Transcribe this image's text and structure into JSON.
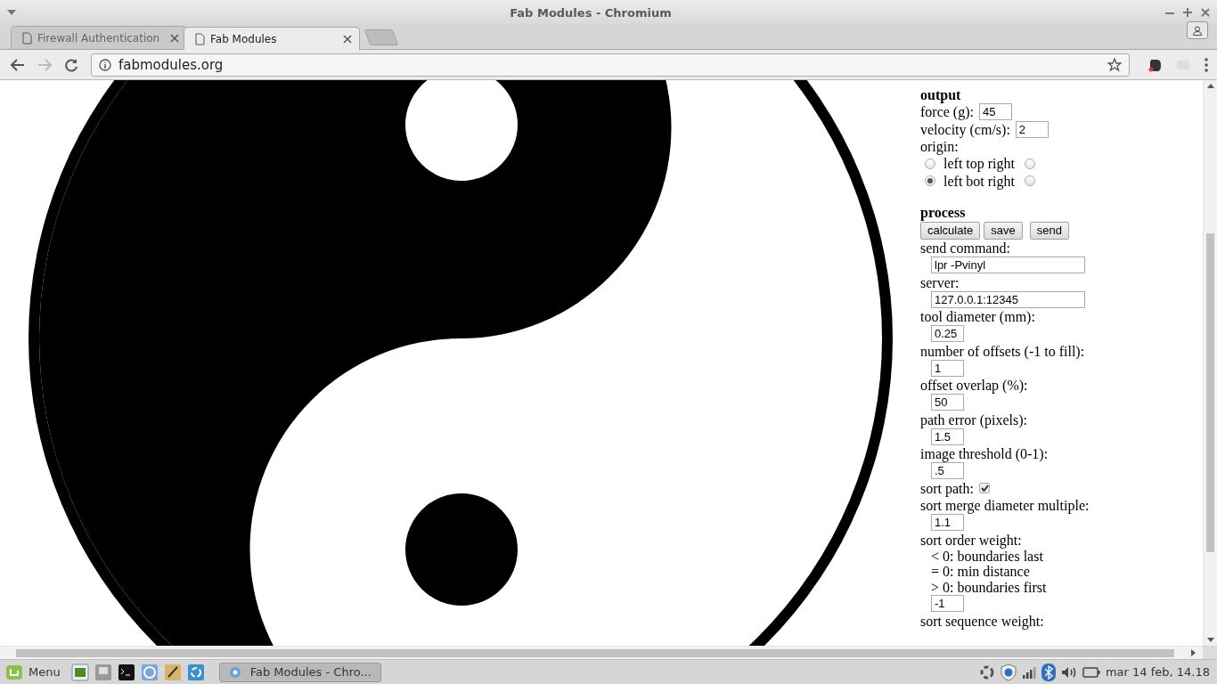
{
  "window": {
    "title": "Fab Modules - Chromium"
  },
  "tabs": [
    {
      "title": "Firewall Authentication",
      "selected": false
    },
    {
      "title": "Fab Modules",
      "selected": true
    }
  ],
  "address_bar": {
    "url": "fabmodules.org"
  },
  "panel": {
    "items": [
      {
        "kind": "heading",
        "text": "output"
      },
      {
        "kind": "inline_field",
        "label": "force (g):",
        "value": "45"
      },
      {
        "kind": "inline_field",
        "label": "velocity (cm/s):",
        "value": "2"
      },
      {
        "kind": "label",
        "text": "origin:"
      },
      {
        "kind": "radio_row",
        "label": "left top right",
        "options": [
          {
            "selected": false
          },
          {
            "selected": false
          }
        ]
      },
      {
        "kind": "radio_row",
        "label": "left bot right",
        "options": [
          {
            "selected": true
          },
          {
            "selected": false
          }
        ]
      },
      {
        "kind": "heading",
        "text": "process"
      },
      {
        "kind": "buttons",
        "buttons": [
          "calculate",
          "save",
          "send"
        ]
      },
      {
        "kind": "label",
        "text": "send command:"
      },
      {
        "kind": "wide_field",
        "value": "lpr -Pvinyl"
      },
      {
        "kind": "label",
        "text": "server:"
      },
      {
        "kind": "wide_field",
        "value": "127.0.0.1:12345"
      },
      {
        "kind": "label",
        "text": "tool diameter (mm):"
      },
      {
        "kind": "short_field",
        "value": "0.25"
      },
      {
        "kind": "label",
        "text": "number of offsets (-1 to fill):"
      },
      {
        "kind": "short_field",
        "value": "1"
      },
      {
        "kind": "label",
        "text": "offset overlap (%):"
      },
      {
        "kind": "short_field",
        "value": "50"
      },
      {
        "kind": "label",
        "text": "path error (pixels):"
      },
      {
        "kind": "short_field",
        "value": "1.5"
      },
      {
        "kind": "label",
        "text": "image threshold (0-1):"
      },
      {
        "kind": "short_field",
        "value": ".5"
      },
      {
        "kind": "checkbox",
        "label": "sort path:",
        "checked": true
      },
      {
        "kind": "label",
        "text": "sort merge diameter multiple:"
      },
      {
        "kind": "short_field",
        "value": "1.1"
      },
      {
        "kind": "label",
        "text": "sort order weight:"
      },
      {
        "kind": "note",
        "text": "< 0: boundaries last"
      },
      {
        "kind": "note",
        "text": "= 0: min distance"
      },
      {
        "kind": "note",
        "text": "> 0: boundaries first"
      },
      {
        "kind": "short_field",
        "value": "-1"
      },
      {
        "kind": "label",
        "text": "sort sequence weight:"
      }
    ]
  },
  "taskbar": {
    "menu_label": "Menu",
    "task": "Fab Modules - Chro...",
    "clock": "mar 14 feb, 14.18"
  }
}
